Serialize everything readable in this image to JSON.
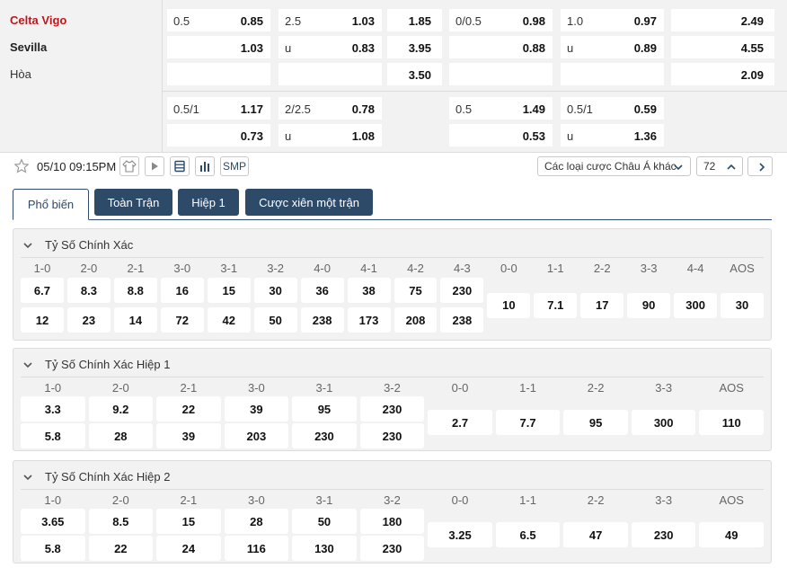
{
  "teams": {
    "home": "Celta Vigo",
    "away": "Sevilla",
    "draw": "Hòa"
  },
  "odds_rows": [
    {
      "cells": [
        {
          "hd": "0.5",
          "od": "0.85"
        },
        {
          "hd": "2.5",
          "od": "1.03"
        },
        {
          "hd": "",
          "od": "1.85"
        },
        {
          "hd": "0/0.5",
          "od": "0.98"
        },
        {
          "hd": "1.0",
          "od": "0.97"
        },
        {
          "hd": "",
          "od": "2.49"
        }
      ]
    },
    {
      "cells": [
        {
          "hd": "",
          "od": "1.03"
        },
        {
          "hd": "u",
          "od": "0.83"
        },
        {
          "hd": "",
          "od": "3.95"
        },
        {
          "hd": "",
          "od": "0.88"
        },
        {
          "hd": "u",
          "od": "0.89"
        },
        {
          "hd": "",
          "od": "4.55"
        }
      ]
    },
    {
      "cells": [
        {
          "hd": "",
          "od": ""
        },
        {
          "hd": "",
          "od": ""
        },
        {
          "hd": "",
          "od": "3.50"
        },
        {
          "hd": "",
          "od": ""
        },
        {
          "hd": "",
          "od": ""
        },
        {
          "hd": "",
          "od": "2.09"
        }
      ]
    },
    {
      "cells": [
        {
          "hd": "0.5/1",
          "od": "1.17"
        },
        {
          "hd": "2/2.5",
          "od": "0.78"
        },
        null,
        {
          "hd": "0.5",
          "od": "1.49"
        },
        {
          "hd": "0.5/1",
          "od": "0.59"
        },
        null
      ]
    },
    {
      "cells": [
        {
          "hd": "",
          "od": "0.73"
        },
        {
          "hd": "u",
          "od": "1.08"
        },
        null,
        {
          "hd": "",
          "od": "0.53"
        },
        {
          "hd": "u",
          "od": "1.36"
        },
        null
      ]
    }
  ],
  "toolbar": {
    "datetime": "05/10 09:15PM",
    "smp_label": "SMP",
    "market_select": "Các loại cược Châu Á khác",
    "market_count": "72"
  },
  "tabs": [
    "Phổ biến",
    "Toàn Trận",
    "Hiệp 1",
    "Cược xiên một trận"
  ],
  "sections": [
    {
      "title": "Tỷ Số Chính Xác",
      "labels": [
        "1-0",
        "2-0",
        "2-1",
        "3-0",
        "3-1",
        "3-2",
        "4-0",
        "4-1",
        "4-2",
        "4-3",
        "0-0",
        "1-1",
        "2-2",
        "3-3",
        "4-4",
        "AOS"
      ],
      "home": [
        "6.7",
        "8.3",
        "8.8",
        "16",
        "15",
        "30",
        "36",
        "38",
        "75",
        "230"
      ],
      "away": [
        "12",
        "23",
        "14",
        "72",
        "42",
        "50",
        "238",
        "173",
        "208",
        "238"
      ],
      "draw": [
        "10",
        "7.1",
        "17",
        "90",
        "300",
        "30"
      ]
    },
    {
      "title": "Tỷ Số Chính Xác Hiệp 1",
      "labels": [
        "1-0",
        "2-0",
        "2-1",
        "3-0",
        "3-1",
        "3-2",
        "0-0",
        "1-1",
        "2-2",
        "3-3",
        "AOS"
      ],
      "home": [
        "3.3",
        "9.2",
        "22",
        "39",
        "95",
        "230"
      ],
      "away": [
        "5.8",
        "28",
        "39",
        "203",
        "230",
        "230"
      ],
      "draw": [
        "2.7",
        "7.7",
        "95",
        "300",
        "110"
      ]
    },
    {
      "title": "Tỷ Số Chính Xác Hiệp 2",
      "labels": [
        "1-0",
        "2-0",
        "2-1",
        "3-0",
        "3-1",
        "3-2",
        "0-0",
        "1-1",
        "2-2",
        "3-3",
        "AOS"
      ],
      "home": [
        "3.65",
        "8.5",
        "15",
        "28",
        "50",
        "180"
      ],
      "away": [
        "5.8",
        "22",
        "24",
        "116",
        "130",
        "230"
      ],
      "draw": [
        "3.25",
        "6.5",
        "47",
        "230",
        "49"
      ]
    }
  ]
}
